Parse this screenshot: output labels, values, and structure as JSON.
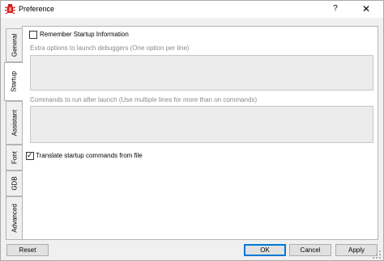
{
  "window": {
    "title": "Preference",
    "help_glyph": "?",
    "close_glyph": "✕",
    "app_icon": "bug-icon"
  },
  "tabs": [
    {
      "label": "General",
      "active": false
    },
    {
      "label": "Startup",
      "active": true
    },
    {
      "label": "Assistant",
      "active": false
    },
    {
      "label": "Font",
      "active": false
    },
    {
      "label": "GDB",
      "active": false
    },
    {
      "label": "Advanced",
      "active": false
    }
  ],
  "startup": {
    "remember_label": "Remember Startup Information",
    "remember_checked": false,
    "extra_options_label": "Extra options to launch debuggers (One option per line)",
    "extra_options_value": "",
    "commands_label": "Commands to run after launch (Use multiple lines for more than on commands)",
    "commands_value": "",
    "translate_label": "Translate startup commands from file",
    "translate_checked": true,
    "check_glyph": "✓"
  },
  "buttons": {
    "reset": "Reset",
    "ok": "OK",
    "cancel": "Cancel",
    "apply": "Apply"
  },
  "colors": {
    "accent": "#0078d7",
    "icon_red": "#d42020"
  }
}
